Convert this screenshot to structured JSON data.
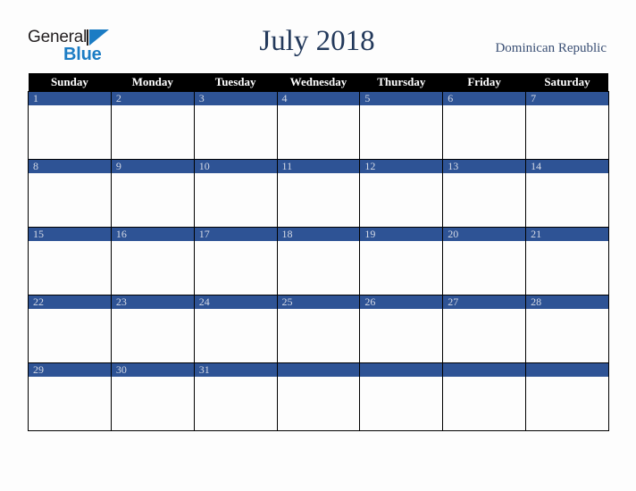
{
  "brand": {
    "logo_text_top": "General",
    "logo_text_bottom": "Blue",
    "logo_top_color": "#231f20",
    "logo_bottom_color": "#1b7cc4",
    "logo_icon": "triangle-flag-icon"
  },
  "header": {
    "title": "July 2018",
    "title_color": "#23395b",
    "country": "Dominican Republic",
    "country_color": "#3a4f74"
  },
  "calendar": {
    "month": "July",
    "year": "2018",
    "header_bg": "#000000",
    "header_text_color": "#ffffff",
    "daynum_bg": "#2e5395",
    "daynum_text_color": "#d5dae6",
    "cell_bg": "#fdfdfd",
    "grid_line_color": "#000000",
    "weekdays": [
      "Sunday",
      "Monday",
      "Tuesday",
      "Wednesday",
      "Thursday",
      "Friday",
      "Saturday"
    ],
    "weeks": [
      [
        {
          "day": "1"
        },
        {
          "day": "2"
        },
        {
          "day": "3"
        },
        {
          "day": "4"
        },
        {
          "day": "5"
        },
        {
          "day": "6"
        },
        {
          "day": "7"
        }
      ],
      [
        {
          "day": "8"
        },
        {
          "day": "9"
        },
        {
          "day": "10"
        },
        {
          "day": "11"
        },
        {
          "day": "12"
        },
        {
          "day": "13"
        },
        {
          "day": "14"
        }
      ],
      [
        {
          "day": "15"
        },
        {
          "day": "16"
        },
        {
          "day": "17"
        },
        {
          "day": "18"
        },
        {
          "day": "19"
        },
        {
          "day": "20"
        },
        {
          "day": "21"
        }
      ],
      [
        {
          "day": "22"
        },
        {
          "day": "23"
        },
        {
          "day": "24"
        },
        {
          "day": "25"
        },
        {
          "day": "26"
        },
        {
          "day": "27"
        },
        {
          "day": "28"
        }
      ],
      [
        {
          "day": "29"
        },
        {
          "day": "30"
        },
        {
          "day": "31"
        },
        {
          "day": ""
        },
        {
          "day": ""
        },
        {
          "day": ""
        },
        {
          "day": ""
        }
      ]
    ]
  }
}
